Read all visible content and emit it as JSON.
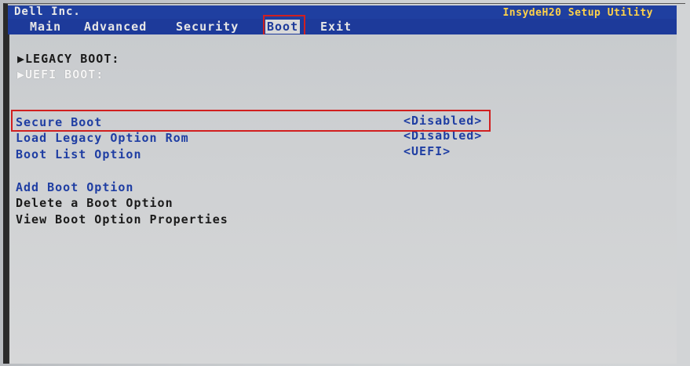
{
  "title_bar": {
    "vendor": "Dell Inc.",
    "product": "InsydeH20 Setup Utility"
  },
  "menu": {
    "items": [
      "Main",
      "Advanced",
      "Security",
      "Boot",
      "Exit"
    ],
    "active": "Boot"
  },
  "boot_groups": {
    "legacy": "▶LEGACY BOOT:",
    "uefi": "▶UEFI BOOT:"
  },
  "settings": [
    {
      "label": "Secure Boot",
      "value": "<Disabled>"
    },
    {
      "label": "Load Legacy Option Rom",
      "value": "<Disabled>"
    },
    {
      "label": "Boot List Option",
      "value": "<UEFI>"
    }
  ],
  "actions": [
    "Add Boot Option",
    "Delete a Boot Option",
    "View Boot Option Properties"
  ],
  "highlight_color": "#d11f1f"
}
